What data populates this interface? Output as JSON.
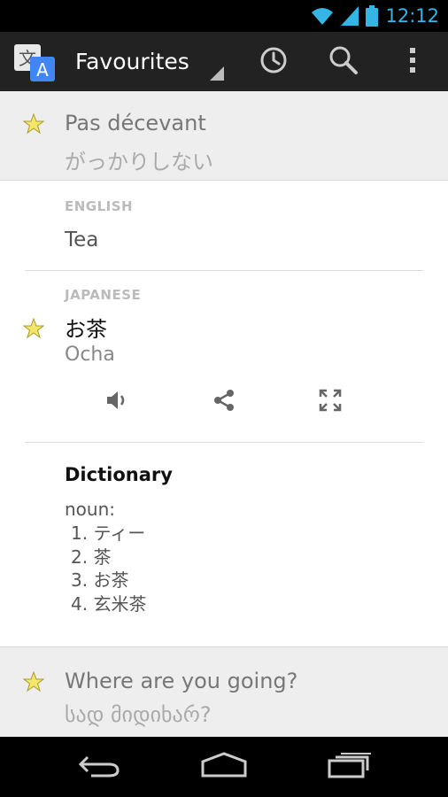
{
  "status_bar": {
    "time": "12:12"
  },
  "action_bar": {
    "title": "Favourites"
  },
  "favourites": [
    {
      "source": "Pas décevant",
      "translation": "がっかりしない"
    },
    {
      "source": "Where are you going?",
      "translation": "სად მიდიხარ?"
    }
  ],
  "expanded": {
    "source_lang": "ENGLISH",
    "source_text": "Tea",
    "target_lang": "JAPANESE",
    "target_text": "お茶",
    "romanization": "Ocha",
    "dictionary": {
      "title": "Dictionary",
      "pos": "noun:",
      "entries": [
        "1. ティー",
        "2. 茶",
        "3. お茶",
        "4. 玄米茶"
      ]
    }
  },
  "colors": {
    "accent": "#33b5e5",
    "star": "#f2e76a",
    "action_bar": "#222222"
  }
}
